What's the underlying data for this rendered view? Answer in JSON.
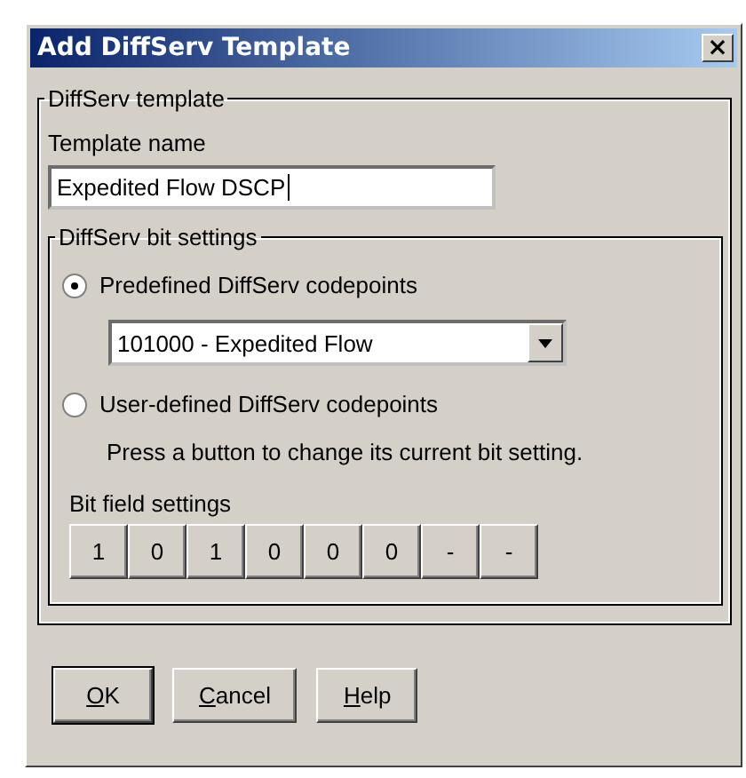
{
  "window": {
    "title": "Add DiffServ Template",
    "close": "×"
  },
  "template_group": {
    "legend": "DiffServ template",
    "name_label": "Template name",
    "name_value": "Expedited Flow DSCP"
  },
  "bit_group": {
    "legend": "DiffServ bit settings",
    "options": [
      {
        "label": "Predefined DiffServ codepoints",
        "selected": true
      },
      {
        "label": "User-defined DiffServ codepoints",
        "selected": false
      }
    ],
    "codepoint_value": "101000 - Expedited Flow",
    "hint": "Press a button to change its current bit setting.",
    "bits_label": "Bit field settings",
    "bits": [
      "1",
      "0",
      "1",
      "0",
      "0",
      "0",
      "-",
      "-"
    ]
  },
  "buttons": [
    {
      "label": "OK",
      "default": true
    },
    {
      "label": "Cancel",
      "default": false
    },
    {
      "label": "Help",
      "default": false
    }
  ]
}
